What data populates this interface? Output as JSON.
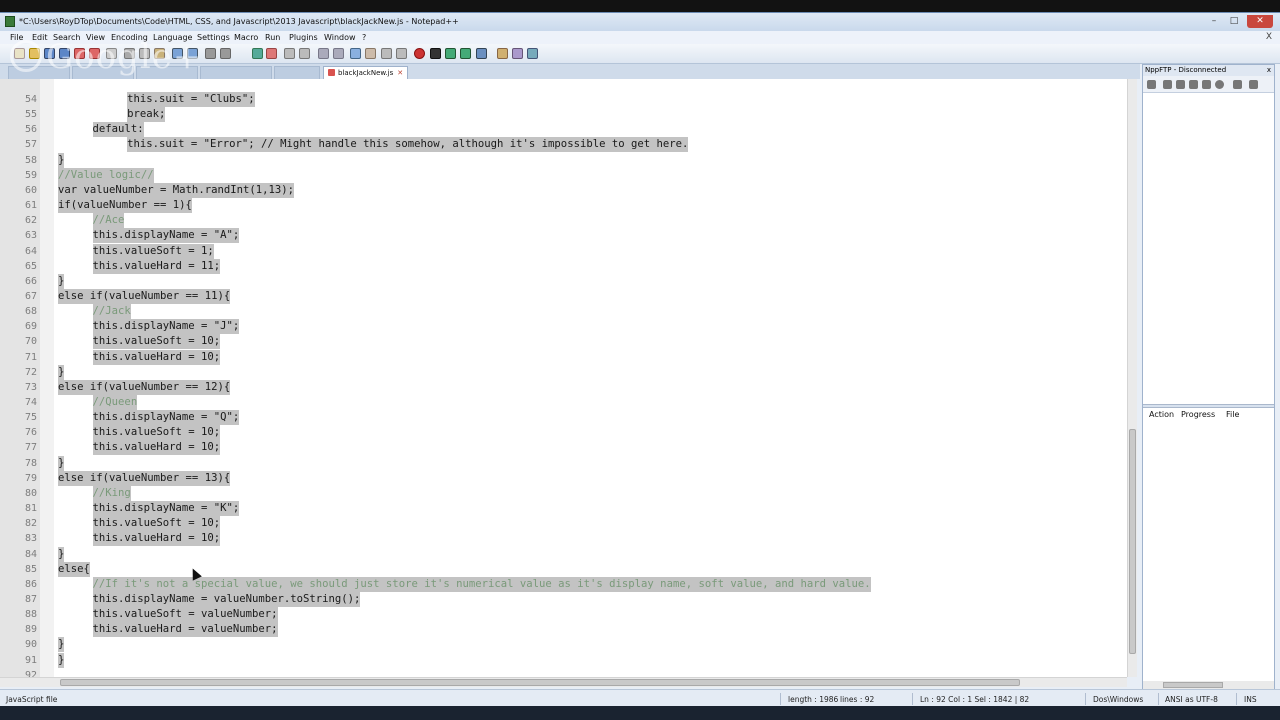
{
  "window": {
    "title": "*C:\\Users\\RoyDTop\\Documents\\Code\\HTML, CSS, and Javascript\\2013 Javascript\\blackJackNew.js - Notepad++",
    "minimize": "–",
    "maximize": "□",
    "close": "✕"
  },
  "menu": {
    "items": [
      "File",
      "Edit",
      "Search",
      "View",
      "Encoding",
      "Language",
      "Settings",
      "Macro",
      "Run",
      "Plugins",
      "Window",
      "?"
    ],
    "close_x": "X"
  },
  "overlay": {
    "watermark": "Google+"
  },
  "tabs": [
    {
      "label": "blackJackNew.js",
      "active": true
    }
  ],
  "editor": {
    "lines": [
      {
        "n": "54",
        "indent": 8,
        "text": "this.suit = \"Clubs\";",
        "sel": true
      },
      {
        "n": "55",
        "indent": 8,
        "text": "break;",
        "sel": true
      },
      {
        "n": "56",
        "indent": 4,
        "text": "default:",
        "sel": true
      },
      {
        "n": "57",
        "indent": 8,
        "text": "this.suit = \"Error\"; // Might handle this somehow, although it's impossible to get here.",
        "sel": true
      },
      {
        "n": "58",
        "indent": 0,
        "text": "}",
        "sel": true
      },
      {
        "n": "59",
        "indent": 0,
        "text": "//Value logic//",
        "sel": true,
        "comment": true
      },
      {
        "n": "60",
        "indent": 0,
        "text": "var valueNumber = Math.randInt(1,13);",
        "sel": true
      },
      {
        "n": "61",
        "indent": 0,
        "text": "if(valueNumber == 1){",
        "sel": true
      },
      {
        "n": "62",
        "indent": 4,
        "text": "//Ace",
        "sel": true,
        "comment": true
      },
      {
        "n": "63",
        "indent": 4,
        "text": "this.displayName = \"A\";",
        "sel": true
      },
      {
        "n": "64",
        "indent": 4,
        "text": "this.valueSoft = 1;",
        "sel": true
      },
      {
        "n": "65",
        "indent": 4,
        "text": "this.valueHard = 11;",
        "sel": true
      },
      {
        "n": "66",
        "indent": 0,
        "text": "}",
        "sel": true
      },
      {
        "n": "67",
        "indent": 0,
        "text": "else if(valueNumber == 11){",
        "sel": true
      },
      {
        "n": "68",
        "indent": 4,
        "text": "//Jack",
        "sel": true,
        "comment": true
      },
      {
        "n": "69",
        "indent": 4,
        "text": "this.displayName = \"J\";",
        "sel": true
      },
      {
        "n": "70",
        "indent": 4,
        "text": "this.valueSoft = 10;",
        "sel": true
      },
      {
        "n": "71",
        "indent": 4,
        "text": "this.valueHard = 10;",
        "sel": true
      },
      {
        "n": "72",
        "indent": 0,
        "text": "}",
        "sel": true
      },
      {
        "n": "73",
        "indent": 0,
        "text": "else if(valueNumber == 12){",
        "sel": true
      },
      {
        "n": "74",
        "indent": 4,
        "text": "//Queen",
        "sel": true,
        "comment": true
      },
      {
        "n": "75",
        "indent": 4,
        "text": "this.displayName = \"Q\";",
        "sel": true
      },
      {
        "n": "76",
        "indent": 4,
        "text": "this.valueSoft = 10;",
        "sel": true
      },
      {
        "n": "77",
        "indent": 4,
        "text": "this.valueHard = 10;",
        "sel": true
      },
      {
        "n": "78",
        "indent": 0,
        "text": "}",
        "sel": true
      },
      {
        "n": "79",
        "indent": 0,
        "text": "else if(valueNumber == 13){",
        "sel": true
      },
      {
        "n": "80",
        "indent": 4,
        "text": "//King",
        "sel": true,
        "comment": true
      },
      {
        "n": "81",
        "indent": 4,
        "text": "this.displayName = \"K\";",
        "sel": true
      },
      {
        "n": "82",
        "indent": 4,
        "text": "this.valueSoft = 10;",
        "sel": true
      },
      {
        "n": "83",
        "indent": 4,
        "text": "this.valueHard = 10;",
        "sel": true
      },
      {
        "n": "84",
        "indent": 0,
        "text": "}",
        "sel": true
      },
      {
        "n": "85",
        "indent": 0,
        "text": "else{",
        "sel": true
      },
      {
        "n": "86",
        "indent": 4,
        "text": "//If it's not a special value, we should just store it's numerical value as it's display name, soft value, and hard value.",
        "sel": true,
        "comment": true
      },
      {
        "n": "87",
        "indent": 4,
        "text": "this.displayName = valueNumber.toString();",
        "sel": true
      },
      {
        "n": "88",
        "indent": 4,
        "text": "this.valueSoft = valueNumber;",
        "sel": true
      },
      {
        "n": "89",
        "indent": 4,
        "text": "this.valueHard = valueNumber;",
        "sel": true
      },
      {
        "n": "90",
        "indent": 0,
        "text": "}",
        "sel": true
      },
      {
        "n": "91",
        "indent": 0,
        "text": "}",
        "sel": true
      },
      {
        "n": "92",
        "indent": 0,
        "text": "",
        "sel": false
      }
    ]
  },
  "ftp_panel": {
    "title": "NppFTP - Disconnected",
    "close": "x",
    "columns": [
      "Action",
      "Progress",
      "File"
    ]
  },
  "status": {
    "file_type": "JavaScript file",
    "length": "length : 1986",
    "lines": "lines : 92",
    "position": "Ln : 92   Col : 1   Sel : 1842 | 82",
    "eol": "Dos\\Windows",
    "encoding": "ANSI as UTF-8",
    "mode": "INS"
  }
}
